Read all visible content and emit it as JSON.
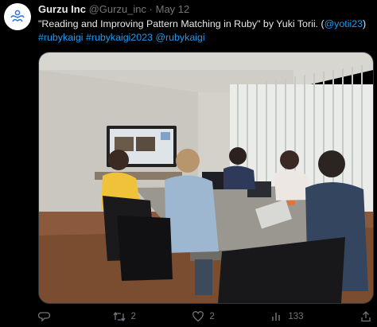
{
  "tweet": {
    "author_name": "Gurzu Inc",
    "author_handle": "@Gurzu_inc",
    "separator": "·",
    "date": "May 12",
    "text_main": "\"Reading and Improving Pattern Matching in Ruby\" by Yuki Torii. (",
    "mention_author": "@yotii23",
    "text_close": ")",
    "hashtag1": "#rubykaigi",
    "hashtag2": "#rubykaigi2023",
    "mention2": "@rubykaigi"
  },
  "actions": {
    "reply_count": "",
    "retweet_count": "2",
    "like_count": "2",
    "views_count": "133"
  },
  "colors": {
    "background": "#000000",
    "text": "#e7e9ea",
    "secondary": "#71767b",
    "link": "#1d9bf0"
  },
  "icons": [
    "gurzu-logo-icon",
    "reply-icon",
    "retweet-icon",
    "like-icon",
    "views-icon",
    "share-icon"
  ]
}
